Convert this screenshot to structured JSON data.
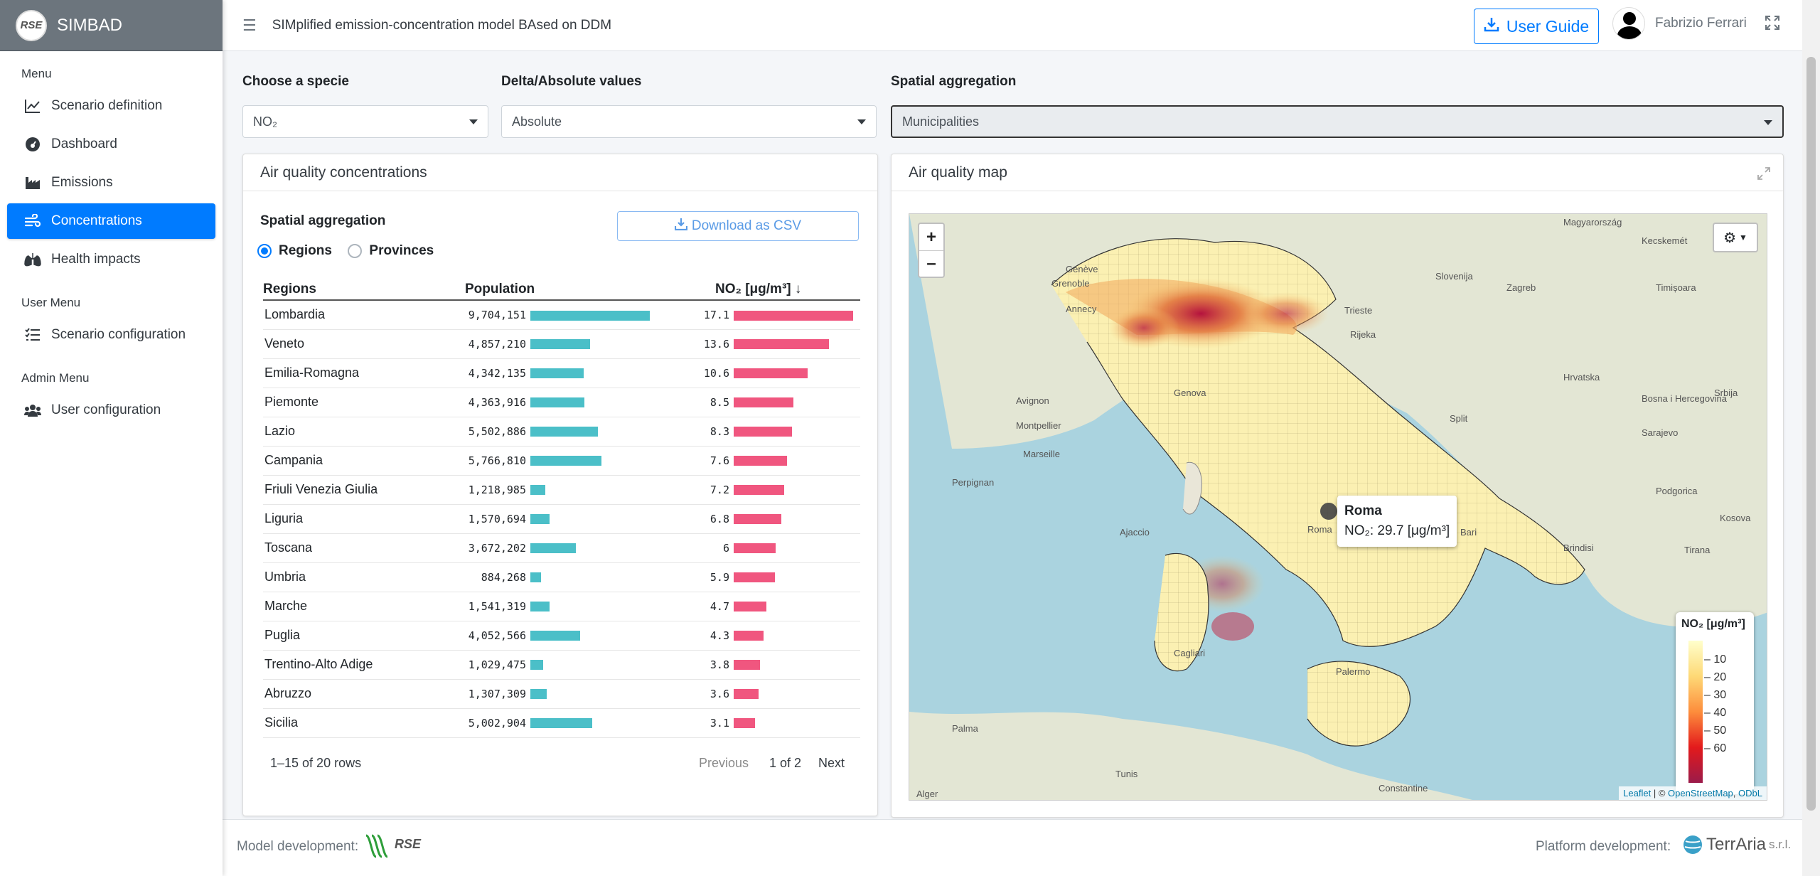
{
  "brand": {
    "name": "SIMBAD",
    "logo_text": "RSE"
  },
  "sidebar": {
    "menu_header": "Menu",
    "items": [
      {
        "label": "Scenario definition",
        "icon": "chart-line-icon"
      },
      {
        "label": "Dashboard",
        "icon": "dashboard-gauge-icon"
      },
      {
        "label": "Emissions",
        "icon": "industry-icon"
      },
      {
        "label": "Concentrations",
        "icon": "wind-icon",
        "active": true
      },
      {
        "label": "Health impacts",
        "icon": "lungs-icon"
      }
    ],
    "user_menu_header": "User Menu",
    "user_items": [
      {
        "label": "Scenario configuration",
        "icon": "list-check-icon"
      }
    ],
    "admin_menu_header": "Admin Menu",
    "admin_items": [
      {
        "label": "User configuration",
        "icon": "users-icon"
      }
    ]
  },
  "topbar": {
    "title": "SIMplified emission-concentration model BAsed on DDM",
    "user_guide": "User Guide",
    "user_name": "Fabrizio Ferrari"
  },
  "filters": {
    "specie_label": "Choose a specie",
    "specie_value": "NO₂",
    "delta_label": "Delta/Absolute values",
    "delta_value": "Absolute",
    "spatial_label": "Spatial aggregation",
    "spatial_value": "Municipalities"
  },
  "concentrations": {
    "title": "Air quality concentrations",
    "spatial_label": "Spatial aggregation",
    "radio_regions": "Regions",
    "radio_provinces": "Provinces",
    "download": "Download as CSV",
    "col_region": "Regions",
    "col_population": "Population",
    "col_no2": "NO₂ [μg/m³] ↓",
    "rows": [
      {
        "region": "Lombardia",
        "population": "9,704,151",
        "pop": 9704151,
        "no2": "17.1"
      },
      {
        "region": "Veneto",
        "population": "4,857,210",
        "pop": 4857210,
        "no2": "13.6"
      },
      {
        "region": "Emilia-Romagna",
        "population": "4,342,135",
        "pop": 4342135,
        "no2": "10.6"
      },
      {
        "region": "Piemonte",
        "population": "4,363,916",
        "pop": 4363916,
        "no2": "8.5"
      },
      {
        "region": "Lazio",
        "population": "5,502,886",
        "pop": 5502886,
        "no2": "8.3"
      },
      {
        "region": "Campania",
        "population": "5,766,810",
        "pop": 5766810,
        "no2": "7.6"
      },
      {
        "region": "Friuli Venezia Giulia",
        "population": "1,218,985",
        "pop": 1218985,
        "no2": "7.2"
      },
      {
        "region": "Liguria",
        "population": "1,570,694",
        "pop": 1570694,
        "no2": "6.8"
      },
      {
        "region": "Toscana",
        "population": "3,672,202",
        "pop": 3672202,
        "no2": "6"
      },
      {
        "region": "Umbria",
        "population": "884,268",
        "pop": 884268,
        "no2": "5.9"
      },
      {
        "region": "Marche",
        "population": "1,541,319",
        "pop": 1541319,
        "no2": "4.7"
      },
      {
        "region": "Puglia",
        "population": "4,052,566",
        "pop": 4052566,
        "no2": "4.3"
      },
      {
        "region": "Trentino-Alto Adige",
        "population": "1,029,475",
        "pop": 1029475,
        "no2": "3.8"
      },
      {
        "region": "Abruzzo",
        "population": "1,307,309",
        "pop": 1307309,
        "no2": "3.6"
      },
      {
        "region": "Sicilia",
        "population": "5,002,904",
        "pop": 5002904,
        "no2": "3.1"
      }
    ],
    "pop_max": 9704151,
    "no2_max": 17.1,
    "pop_color": "#4bbfc8",
    "no2_color": "#f0567f",
    "rows_info": "1–15 of 20 rows",
    "previous": "Previous",
    "page": "1 of 2",
    "next": "Next"
  },
  "map": {
    "title": "Air quality map",
    "tooltip_title": "Roma",
    "tooltip_value": "NO₂: 29.7 [μg/m³]",
    "legend_title": "NO₂ [μg/m³]",
    "legend_ticks": [
      "10",
      "20",
      "30",
      "40",
      "50",
      "60"
    ],
    "attribution_leaflet": "Leaflet",
    "attribution_sep": " | © ",
    "attribution_osm": "OpenStreetMap",
    "attribution_odbl": "ODbL",
    "labels": [
      "Magyarország",
      "Kecskemét",
      "Slovenija",
      "Zagreb",
      "Timișoara",
      "Hrvatska",
      "Bosna i Hercegovina",
      "Srbija",
      "Marseille",
      "Genova",
      "Roma",
      "Bari",
      "Palermo",
      "Cagliari",
      "Ajaccio",
      "Perpignan",
      "Montpellier",
      "Avignon",
      "Trieste",
      "Rijeka",
      "Split",
      "Sarajevo",
      "Podgorica",
      "Tirana",
      "Brindisi",
      "Kosova",
      "Constantine",
      "Alger",
      "Annecy",
      "Grenoble",
      "Genève",
      "Palma",
      "Tunis"
    ]
  },
  "footer": {
    "model_dev": "Model development:",
    "platform_dev": "Platform development:",
    "terraria": "TerrAria",
    "terraria_suffix": "s.r.l.",
    "rse_logo": "RSE"
  }
}
